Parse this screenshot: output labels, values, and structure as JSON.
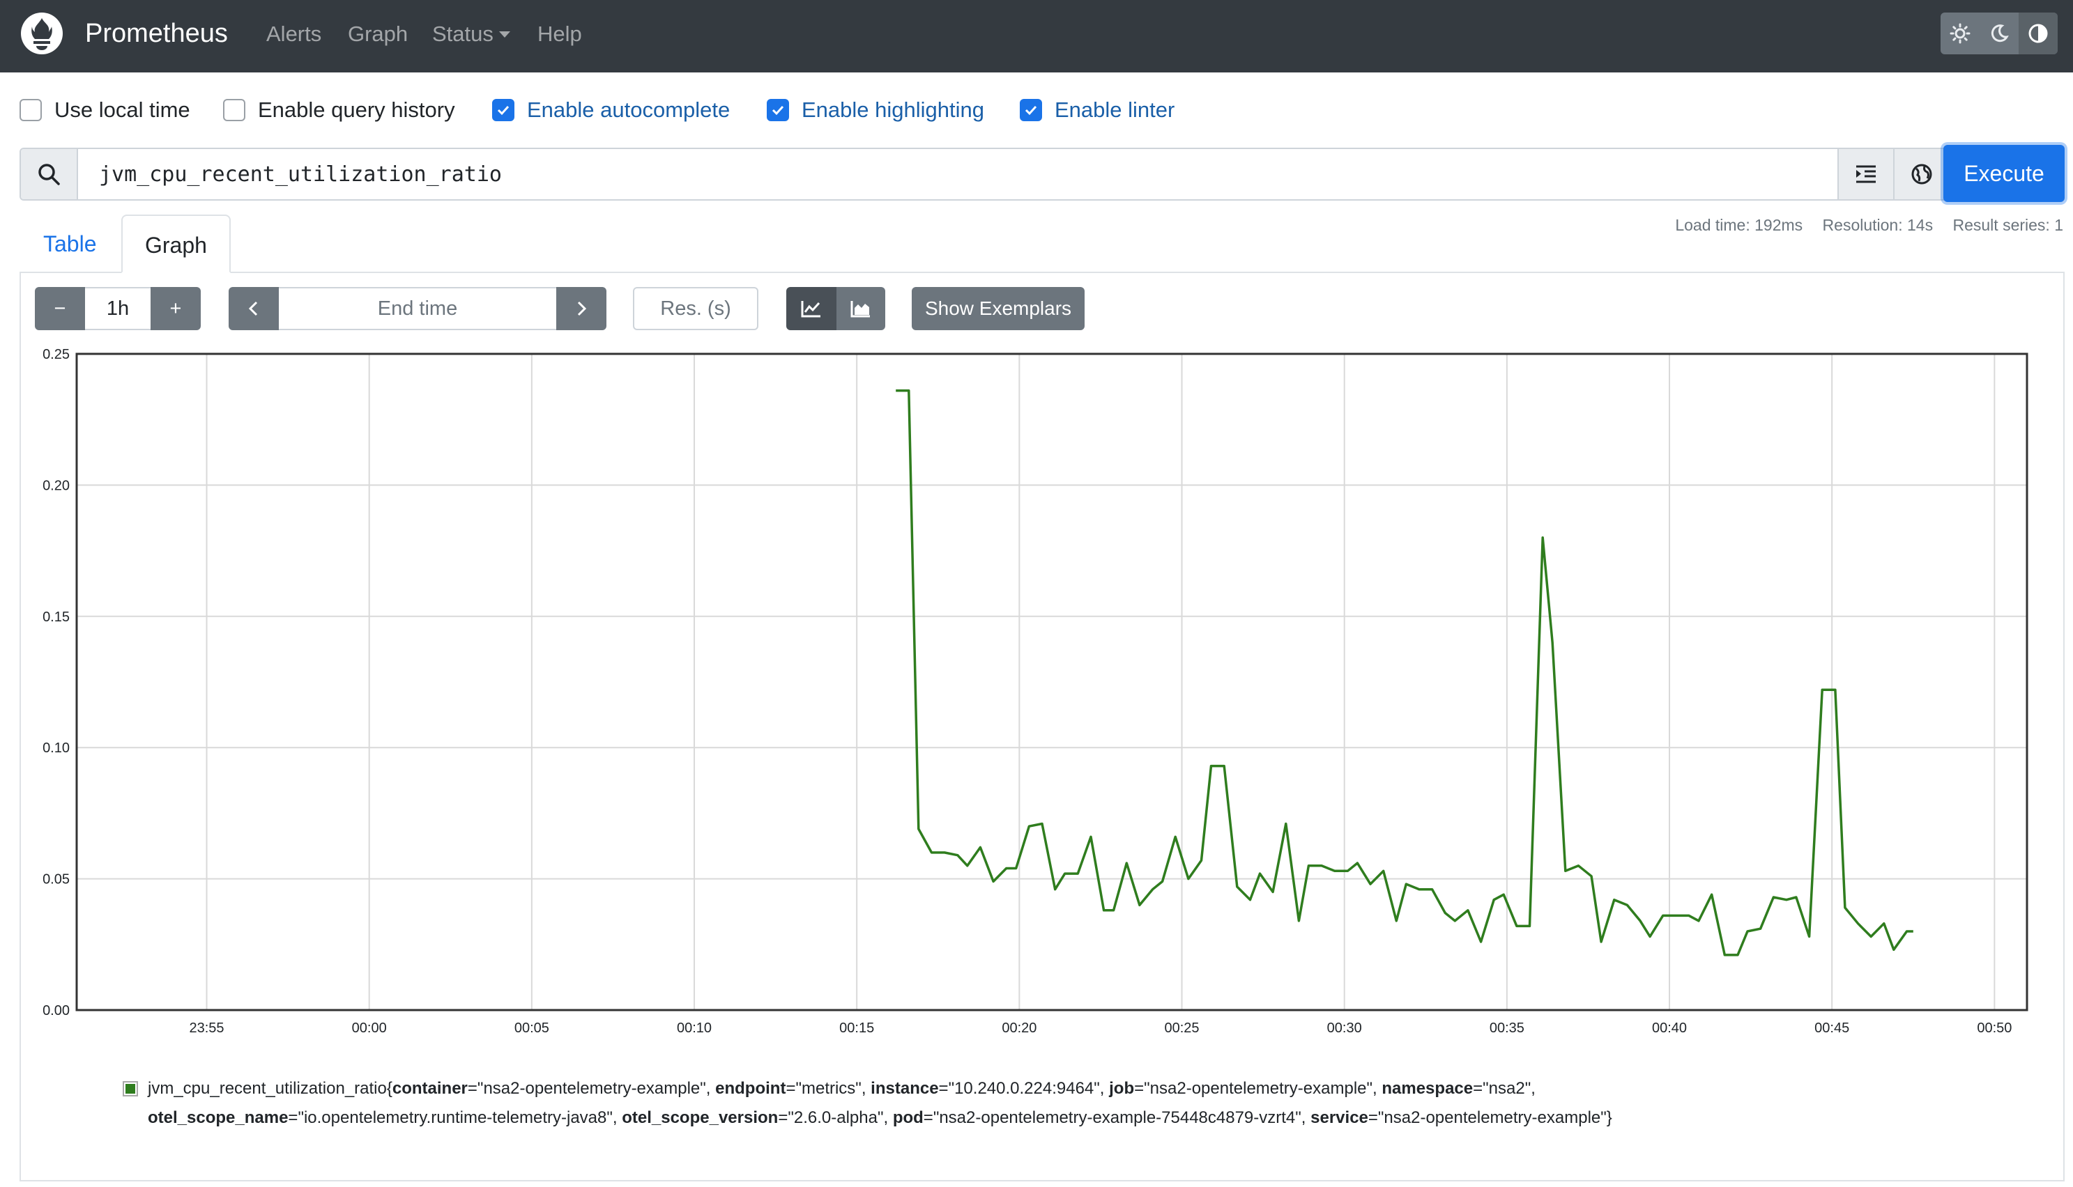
{
  "navbar": {
    "brand": "Prometheus",
    "links": [
      "Alerts",
      "Graph",
      "Status",
      "Help"
    ],
    "theme_icons": [
      "sun-icon",
      "moon-icon",
      "contrast-icon"
    ]
  },
  "options": [
    {
      "label": "Use local time",
      "checked": false
    },
    {
      "label": "Enable query history",
      "checked": false
    },
    {
      "label": "Enable autocomplete",
      "checked": true
    },
    {
      "label": "Enable highlighting",
      "checked": true
    },
    {
      "label": "Enable linter",
      "checked": true
    }
  ],
  "query": {
    "expression": "jvm_cpu_recent_utilization_ratio",
    "execute_label": "Execute"
  },
  "stats": {
    "load_time": "Load time: 192ms",
    "resolution": "Resolution: 14s",
    "result_series": "Result series: 1"
  },
  "tabs": {
    "table": "Table",
    "graph": "Graph"
  },
  "controls": {
    "range": "1h",
    "minus": "−",
    "plus": "+",
    "end_time_placeholder": "End time",
    "res_placeholder": "Res. (s)",
    "show_exemplars": "Show Exemplars"
  },
  "colors": {
    "series": "#2f7d1e",
    "navbar": "#343a40",
    "accent": "#1a73e8"
  },
  "chart_data": {
    "type": "line",
    "y_ticks": [
      "0.25",
      "0.20",
      "0.15",
      "0.10",
      "0.05",
      "0.00"
    ],
    "x_ticks": [
      "23:55",
      "00:00",
      "00:05",
      "00:10",
      "00:15",
      "00:20",
      "00:25",
      "00:30",
      "00:35",
      "00:40",
      "00:45",
      "00:50"
    ],
    "ylim": [
      0,
      0.25
    ],
    "xlim_minutes": [
      -9.0,
      51.0
    ],
    "grid": true,
    "series": [
      {
        "name": "jvm_cpu_recent_utilization_ratio",
        "points": [
          [
            16.2,
            0.236
          ],
          [
            16.6,
            0.236
          ],
          [
            16.9,
            0.069
          ],
          [
            17.3,
            0.06
          ],
          [
            17.7,
            0.06
          ],
          [
            18.1,
            0.059
          ],
          [
            18.4,
            0.055
          ],
          [
            18.8,
            0.062
          ],
          [
            19.2,
            0.049
          ],
          [
            19.6,
            0.054
          ],
          [
            19.9,
            0.054
          ],
          [
            20.3,
            0.07
          ],
          [
            20.7,
            0.071
          ],
          [
            21.1,
            0.046
          ],
          [
            21.4,
            0.052
          ],
          [
            21.8,
            0.052
          ],
          [
            22.2,
            0.066
          ],
          [
            22.6,
            0.038
          ],
          [
            22.9,
            0.038
          ],
          [
            23.3,
            0.056
          ],
          [
            23.7,
            0.04
          ],
          [
            24.1,
            0.046
          ],
          [
            24.4,
            0.049
          ],
          [
            24.8,
            0.066
          ],
          [
            25.2,
            0.05
          ],
          [
            25.6,
            0.057
          ],
          [
            25.9,
            0.093
          ],
          [
            26.3,
            0.093
          ],
          [
            26.7,
            0.047
          ],
          [
            27.1,
            0.042
          ],
          [
            27.4,
            0.052
          ],
          [
            27.8,
            0.045
          ],
          [
            28.2,
            0.071
          ],
          [
            28.6,
            0.034
          ],
          [
            28.9,
            0.055
          ],
          [
            29.3,
            0.055
          ],
          [
            29.7,
            0.053
          ],
          [
            30.1,
            0.053
          ],
          [
            30.4,
            0.056
          ],
          [
            30.8,
            0.048
          ],
          [
            31.2,
            0.053
          ],
          [
            31.6,
            0.034
          ],
          [
            31.9,
            0.048
          ],
          [
            32.3,
            0.046
          ],
          [
            32.7,
            0.046
          ],
          [
            33.1,
            0.037
          ],
          [
            33.4,
            0.034
          ],
          [
            33.8,
            0.038
          ],
          [
            34.2,
            0.026
          ],
          [
            34.6,
            0.042
          ],
          [
            34.9,
            0.044
          ],
          [
            35.3,
            0.032
          ],
          [
            35.7,
            0.032
          ],
          [
            36.1,
            0.18
          ],
          [
            36.4,
            0.14
          ],
          [
            36.8,
            0.053
          ],
          [
            37.2,
            0.055
          ],
          [
            37.6,
            0.051
          ],
          [
            37.9,
            0.026
          ],
          [
            38.3,
            0.042
          ],
          [
            38.7,
            0.04
          ],
          [
            39.1,
            0.034
          ],
          [
            39.4,
            0.028
          ],
          [
            39.8,
            0.036
          ],
          [
            40.2,
            0.036
          ],
          [
            40.6,
            0.036
          ],
          [
            40.9,
            0.034
          ],
          [
            41.3,
            0.044
          ],
          [
            41.7,
            0.021
          ],
          [
            42.1,
            0.021
          ],
          [
            42.4,
            0.03
          ],
          [
            42.8,
            0.031
          ],
          [
            43.2,
            0.043
          ],
          [
            43.6,
            0.042
          ],
          [
            43.9,
            0.043
          ],
          [
            44.3,
            0.028
          ],
          [
            44.7,
            0.122
          ],
          [
            45.1,
            0.122
          ],
          [
            45.4,
            0.039
          ],
          [
            45.8,
            0.033
          ],
          [
            46.2,
            0.028
          ],
          [
            46.6,
            0.033
          ],
          [
            46.9,
            0.023
          ],
          [
            47.3,
            0.03
          ],
          [
            47.5,
            0.03
          ]
        ]
      }
    ]
  },
  "legend": {
    "metric": "jvm_cpu_recent_utilization_ratio",
    "labels": [
      {
        "key": "container",
        "value": "\"nsa2-opentelemetry-example\""
      },
      {
        "key": "endpoint",
        "value": "\"metrics\""
      },
      {
        "key": "instance",
        "value": "\"10.240.0.224:9464\""
      },
      {
        "key": "job",
        "value": "\"nsa2-opentelemetry-example\""
      },
      {
        "key": "namespace",
        "value": "\"nsa2\""
      },
      {
        "key": "otel_scope_name",
        "value": "\"io.opentelemetry.runtime-telemetry-java8\""
      },
      {
        "key": "otel_scope_version",
        "value": "\"2.6.0-alpha\""
      },
      {
        "key": "pod",
        "value": "\"nsa2-opentelemetry-example-75448c4879-vzrt4\""
      },
      {
        "key": "service",
        "value": "\"nsa2-opentelemetry-example\""
      }
    ]
  }
}
